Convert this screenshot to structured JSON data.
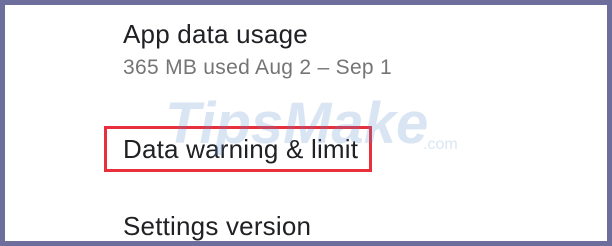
{
  "settings": {
    "app_data_usage": {
      "title": "App data usage",
      "summary": "365 MB used Aug 2 – Sep 1"
    },
    "data_warning": {
      "title": "Data warning & limit"
    },
    "settings_version": {
      "title": "Settings version"
    }
  },
  "watermark": {
    "brand": "TipsMake",
    "suffix": ".com"
  },
  "colors": {
    "frame_border": "#6e6e9c",
    "highlight": "#e8303c",
    "title_text": "#202124",
    "summary_text": "#757575",
    "watermark": "#5b8ccf"
  }
}
